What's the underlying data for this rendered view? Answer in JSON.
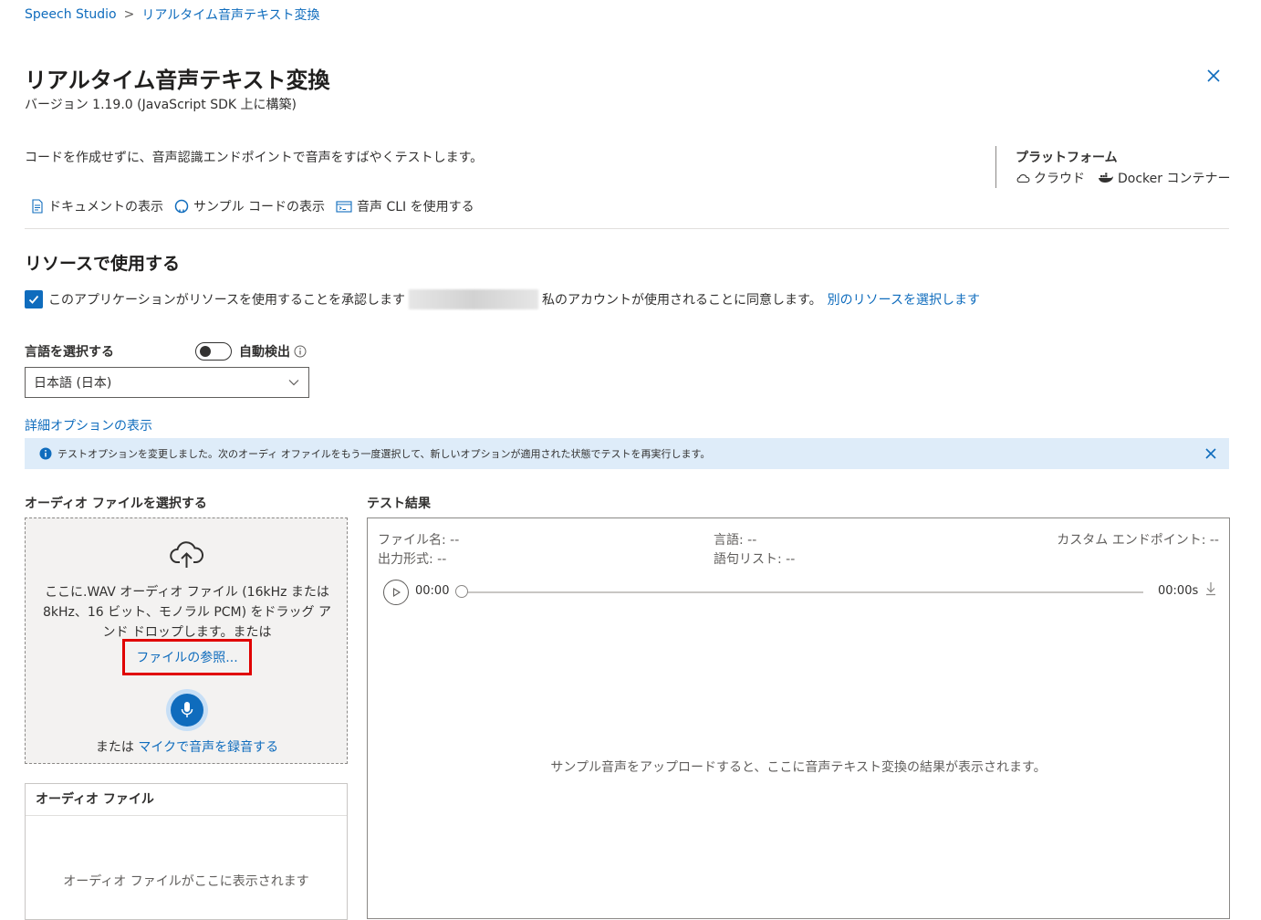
{
  "breadcrumb": {
    "root": "Speech Studio",
    "separator": ">",
    "current": "リアルタイム音声テキスト変換"
  },
  "header": {
    "title": "リアルタイム音声テキスト変換",
    "version": "バージョン 1.19.0 (JavaScript SDK 上に構築)",
    "close_icon": "close-icon"
  },
  "description": "コードを作成せずに、音声認識エンドポイントで音声をすばやくテストします。",
  "platform": {
    "title": "プラットフォーム",
    "items": [
      {
        "icon": "cloud-icon",
        "label": "クラウド"
      },
      {
        "icon": "docker-icon",
        "label": "Docker コンテナー"
      }
    ]
  },
  "links": [
    {
      "icon": "document-icon",
      "label": "ドキュメントの表示"
    },
    {
      "icon": "github-icon",
      "label": "サンプル コードの表示"
    },
    {
      "icon": "cli-icon",
      "label": "音声 CLI を使用する"
    }
  ],
  "resource": {
    "heading": "リソースで使用する",
    "consent_text": "このアプリケーションがリソースを使用することを承認します",
    "consent_suffix": "私のアカウントが使用されることに同意します。",
    "change_link": "別のリソースを選択します",
    "checked": true
  },
  "language": {
    "label": "言語を選択する",
    "auto_detect_label": "自動検出",
    "auto_detect_on": false,
    "selected": "日本語 (日本)"
  },
  "advanced_link": "詳細オプションの表示",
  "info_bar": {
    "message": "テストオプションを変更しました。次のオーディ オファイルをもう一度選択して、新しいオプションが適用された状態でテストを再実行します。",
    "bg_color": "#deecf9"
  },
  "audio_select": {
    "heading": "オーディオ ファイルを選択する",
    "drop_text": "ここに.WAV オーディオ ファイル (16kHz または 8kHz、16 ビット、モノラル PCM) をドラッグ アンド ドロップします。または",
    "browse_link": "ファイルの参照...",
    "record_prefix": "または",
    "record_link": "マイクで音声を録音する"
  },
  "audio_files": {
    "title": "オーディオ ファイル",
    "empty": "オーディオ ファイルがここに表示されます"
  },
  "results": {
    "heading": "テスト結果",
    "file_name": "ファイル名: --",
    "output_format": "出力形式: --",
    "language": "言語: --",
    "phrase_list": "語句リスト: --",
    "custom_endpoint": "カスタム エンドポイント: --",
    "current_time": "00:00",
    "duration": "00:00s",
    "empty": "サンプル音声をアップロードすると、ここに音声テキスト変換の結果が表示されます。"
  },
  "colors": {
    "accent": "#0f6cbd",
    "highlight_border": "#e00000"
  }
}
